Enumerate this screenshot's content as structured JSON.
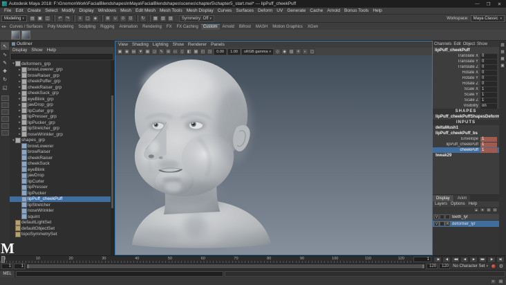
{
  "window": {
    "title": "Autodesk Maya 2018: F:\\GnomonWork\\FacialBlendshapesInMaya\\FacialBlendshapes\\scenes\\chapter5\\chapter5_start.mel* --- lipPuff_cheekPuff",
    "controls": {
      "minimize": "—",
      "maximize": "❐",
      "close": "✕"
    }
  },
  "icons": {
    "dropdown_arrow": "▾",
    "gear": "⚙"
  },
  "menubar": {
    "items": [
      "File",
      "Edit",
      "Create",
      "Select",
      "Modify",
      "Display",
      "Windows",
      "Mesh",
      "Edit Mesh",
      "Mesh Tools",
      "Mesh Display",
      "Curves",
      "Surfaces",
      "Deform",
      "UV",
      "Generate",
      "Cache",
      "Arnold",
      "Bonus Tools",
      "Help"
    ]
  },
  "status": {
    "menu_set": "Modeling",
    "icons": [
      {
        "name": "new-scene-icon",
        "glyph": "▤"
      },
      {
        "name": "open-scene-icon",
        "glyph": "▣"
      },
      {
        "name": "save-scene-icon",
        "glyph": "◫"
      },
      {
        "name": "separator"
      },
      {
        "name": "undo-icon",
        "glyph": "↶"
      },
      {
        "name": "redo-icon",
        "glyph": "↷"
      },
      {
        "name": "separator"
      },
      {
        "name": "select-hierarchy-icon",
        "glyph": "≡"
      },
      {
        "name": "select-object-icon",
        "glyph": "▢"
      },
      {
        "name": "select-component-icon",
        "glyph": "◈"
      },
      {
        "name": "separator"
      },
      {
        "name": "snap-grid-icon",
        "glyph": "⊞"
      },
      {
        "name": "snap-curve-icon",
        "glyph": "∪"
      },
      {
        "name": "snap-point-icon",
        "glyph": "⊙"
      },
      {
        "name": "snap-plane-icon",
        "glyph": "⊡"
      },
      {
        "name": "separator"
      },
      {
        "name": "construction-history-icon",
        "glyph": "↻"
      },
      {
        "name": "separator"
      },
      {
        "name": "render-icon",
        "glyph": "▦"
      },
      {
        "name": "ipr-render-icon",
        "glyph": "▧"
      },
      {
        "name": "render-settings-icon",
        "glyph": "▨"
      }
    ],
    "symmetry_label": "Symmetry:",
    "symmetry_value": "Off",
    "workspace_label": "Workspace:",
    "workspace_value": "Maya Classic"
  },
  "shelf": {
    "nav": [
      {
        "name": "shelf-prev-icon",
        "glyph": "◂"
      },
      {
        "name": "shelf-next-icon",
        "glyph": "▸"
      }
    ],
    "tabs": [
      "Curves / Surfaces",
      "Poly Modeling",
      "Sculpting",
      "Rigging",
      "Animation",
      "Rendering",
      "FX",
      "FX Caching",
      "Custom",
      "Arnold",
      "Bifrost",
      "MASH",
      "Motion Graphics",
      "XGen"
    ],
    "active_tab": "Custom",
    "buttons": [
      {
        "name": "shelf-button-1"
      },
      {
        "name": "shelf-button-2"
      }
    ]
  },
  "toolbox": {
    "tools": [
      {
        "name": "select-tool",
        "glyph": "↖",
        "active": true
      },
      {
        "name": "lasso-tool",
        "glyph": "∿"
      },
      {
        "name": "paint-select-tool",
        "glyph": "✎"
      },
      {
        "name": "move-tool",
        "glyph": "✚"
      },
      {
        "name": "rotate-tool",
        "glyph": "↻"
      },
      {
        "name": "scale-tool",
        "glyph": "◱"
      }
    ],
    "layouts": [
      "single-pane-layout",
      "four-pane-layout",
      "persp-outliner-layout",
      "persp-graph-layout",
      "hypershade-persp-layout",
      "outliner-persp-layout"
    ]
  },
  "outliner": {
    "title": "Outliner",
    "menus": [
      "Display",
      "Show",
      "Help"
    ],
    "items": [
      {
        "label": "deformers_grp",
        "level": 0,
        "type": "group",
        "arrow": "▾"
      },
      {
        "label": "browLowerer_grp",
        "level": 1,
        "type": "group",
        "arrow": "▸"
      },
      {
        "label": "browRaiser_grp",
        "level": 1,
        "type": "group",
        "arrow": "▸"
      },
      {
        "label": "cheekPuffer_grp",
        "level": 1,
        "type": "group",
        "arrow": "▸"
      },
      {
        "label": "cheekRaiser_grp",
        "level": 1,
        "type": "group",
        "arrow": "▸"
      },
      {
        "label": "cheekSuck_grp",
        "level": 1,
        "type": "group",
        "arrow": "▸"
      },
      {
        "label": "eyeBlink_grp",
        "level": 1,
        "type": "group",
        "arrow": "▸"
      },
      {
        "label": "jawDrop_grp",
        "level": 1,
        "type": "group",
        "arrow": "▸"
      },
      {
        "label": "lipCurler_grp",
        "level": 1,
        "type": "group",
        "arrow": "▸"
      },
      {
        "label": "lipPresser_grp",
        "level": 1,
        "type": "group",
        "arrow": "▸"
      },
      {
        "label": "lipPucker_grp",
        "level": 1,
        "type": "group",
        "arrow": "▸"
      },
      {
        "label": "lipStretcher_grp",
        "level": 1,
        "type": "group",
        "arrow": "▸"
      },
      {
        "label": "noseWrinkler_grp",
        "level": 1,
        "type": "group",
        "arrow": "▸"
      },
      {
        "label": "shapes_grp",
        "level": 0,
        "type": "group",
        "arrow": "▾"
      },
      {
        "label": "browLowerer",
        "level": 1,
        "type": "mesh"
      },
      {
        "label": "browRaiser",
        "level": 1,
        "type": "mesh"
      },
      {
        "label": "cheekRaiser",
        "level": 1,
        "type": "mesh"
      },
      {
        "label": "cheekSuck",
        "level": 1,
        "type": "mesh"
      },
      {
        "label": "eyeBlink",
        "level": 1,
        "type": "mesh"
      },
      {
        "label": "jawDrop",
        "level": 1,
        "type": "mesh"
      },
      {
        "label": "lipCurler",
        "level": 1,
        "type": "mesh"
      },
      {
        "label": "lipPresser",
        "level": 1,
        "type": "mesh"
      },
      {
        "label": "lipPucker",
        "level": 1,
        "type": "mesh"
      },
      {
        "label": "lipPuff_cheekPuff",
        "level": 1,
        "type": "mesh",
        "selected": true
      },
      {
        "label": "lipStretcher",
        "level": 1,
        "type": "mesh"
      },
      {
        "label": "noseWrinkler",
        "level": 1,
        "type": "mesh"
      },
      {
        "label": "squint",
        "level": 1,
        "type": "mesh"
      },
      {
        "label": "defaultLightSet",
        "level": 0,
        "type": "set"
      },
      {
        "label": "defaultObjectSet",
        "level": 0,
        "type": "set"
      },
      {
        "label": "topoSymmetrySet",
        "level": 0,
        "type": "set"
      }
    ]
  },
  "viewport": {
    "menus": [
      "View",
      "Shading",
      "Lighting",
      "Show",
      "Renderer",
      "Panels"
    ],
    "toolbar": {
      "icons_left": [
        {
          "name": "select-camera-icon",
          "glyph": "▣"
        },
        {
          "name": "lock-camera-icon",
          "glyph": "◉"
        },
        {
          "name": "camera-attributes-icon",
          "glyph": "▤"
        },
        {
          "name": "bookmark-icon",
          "glyph": "▼"
        },
        {
          "name": "image-plane-icon",
          "glyph": "▦"
        },
        {
          "name": "two-d-pan-zoom-icon",
          "glyph": "◲"
        },
        {
          "name": "grease-pencil-icon",
          "glyph": "✎"
        },
        {
          "name": "grid-icon",
          "glyph": "⊞"
        },
        {
          "name": "film-gate-icon",
          "glyph": "▭"
        },
        {
          "name": "resolution-gate-icon",
          "glyph": "▯"
        },
        {
          "name": "gate-mask-icon",
          "glyph": "◧"
        },
        {
          "name": "field-chart-icon",
          "glyph": "▩"
        },
        {
          "name": "safe-action-icon",
          "glyph": "◰"
        },
        {
          "name": "safe-title-icon",
          "glyph": "◳"
        }
      ],
      "exposure": "0.00",
      "gamma": "1.00",
      "color_mode": "sRGB gamma",
      "icons_right": [
        {
          "name": "wireframe-icon",
          "glyph": "◇"
        },
        {
          "name": "shaded-icon",
          "glyph": "◆"
        },
        {
          "name": "textured-icon",
          "glyph": "▨"
        },
        {
          "name": "lights-icon",
          "glyph": "☀"
        },
        {
          "name": "shadows-icon",
          "glyph": "◐"
        },
        {
          "name": "xray-icon",
          "glyph": "◻"
        }
      ]
    }
  },
  "channel_box": {
    "tabs": [
      "Channels",
      "Edit",
      "Object",
      "Show"
    ],
    "object_name": "lipPuff_cheekPuff",
    "channels": [
      {
        "name": "Translate X",
        "value": "0"
      },
      {
        "name": "Translate Y",
        "value": "0"
      },
      {
        "name": "Translate Z",
        "value": "0"
      },
      {
        "name": "Rotate X",
        "value": "0"
      },
      {
        "name": "Rotate Y",
        "value": "0"
      },
      {
        "name": "Rotate Z",
        "value": "0"
      },
      {
        "name": "Scale X",
        "value": "1"
      },
      {
        "name": "Scale Y",
        "value": "1"
      },
      {
        "name": "Scale Z",
        "value": "1"
      },
      {
        "name": "Visibility",
        "value": "on"
      }
    ],
    "shapes_header": "SHAPES",
    "shape_node": "lipPuff_cheekPuffShapesDeformed",
    "inputs_header": "INPUTS",
    "input_nodes": [
      {
        "name": "deltaMush1",
        "channels": []
      },
      {
        "name": "lipPuff_cheekPuff_bs",
        "channels": [
          {
            "name": "Envelope",
            "value": "1",
            "keyed": true
          },
          {
            "name": "lipPuff_cheekPuff",
            "value": "1",
            "keyed": true
          },
          {
            "name": "cheekPuff",
            "value": "1",
            "keyed": true,
            "selected": true
          }
        ]
      },
      {
        "name": "tweak29",
        "channels": []
      }
    ]
  },
  "layer_editor": {
    "tabs": [
      "Display",
      "Anim"
    ],
    "active_tab": "Display",
    "menus": [
      "Layers",
      "Options",
      "Help"
    ],
    "toolbar_icons": [
      {
        "name": "move-layer-up-icon",
        "glyph": "▴"
      },
      {
        "name": "move-layer-down-icon",
        "glyph": "▾"
      },
      {
        "name": "new-empty-layer-icon",
        "glyph": "⊞"
      },
      {
        "name": "new-layer-from-selected-icon",
        "glyph": "⊟"
      }
    ],
    "layers": [
      {
        "name": "teeth_lyr",
        "vis": "V",
        "type": "",
        "selected": false
      },
      {
        "name": "deformer_lyr",
        "vis": "V",
        "type": "R",
        "selected": true
      }
    ]
  },
  "right_strip": [
    {
      "name": "channel-box-toggle-icon",
      "glyph": "▥"
    },
    {
      "name": "attribute-editor-toggle-icon",
      "glyph": "▤"
    },
    {
      "name": "tool-settings-toggle-icon",
      "glyph": "▦"
    },
    {
      "name": "modeling-toolkit-toggle-icon",
      "glyph": "▣"
    }
  ],
  "timeline": {
    "ticks": [
      "1",
      "10",
      "20",
      "30",
      "40",
      "50",
      "60",
      "70",
      "80",
      "90",
      "100",
      "110",
      "120"
    ],
    "current_frame": "1",
    "transport": [
      {
        "name": "go-to-start-button",
        "glyph": "|◀"
      },
      {
        "name": "step-back-frame-button",
        "glyph": "◀|"
      },
      {
        "name": "step-back-key-button",
        "glyph": "◀◀"
      },
      {
        "name": "play-backwards-button",
        "glyph": "◀"
      },
      {
        "name": "play-forwards-button",
        "glyph": "▶"
      },
      {
        "name": "step-forward-key-button",
        "glyph": "▶▶"
      },
      {
        "name": "step-forward-frame-button",
        "glyph": "|▶"
      },
      {
        "name": "go-to-end-button",
        "glyph": "▶|"
      }
    ]
  },
  "range": {
    "start": "1",
    "pb_start": "1",
    "pb_end": "120",
    "end": "120",
    "character_set": "No Character Set"
  },
  "command_line": {
    "mode_label": "MEL",
    "help_text": ""
  },
  "help_icons": [
    {
      "name": "script-editor-icon",
      "glyph": "≡"
    },
    {
      "name": "content-browser-icon",
      "glyph": "▤"
    }
  ],
  "watermark": "M",
  "colors": {
    "selection_blue": "#3f6e9e",
    "keyed_red": "#a05a50",
    "viewport_top": "#414c59",
    "viewport_bottom": "#86909d",
    "accent": "#5285a6"
  }
}
